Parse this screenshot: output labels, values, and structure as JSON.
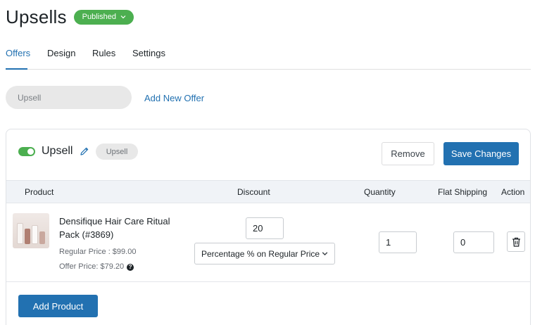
{
  "header": {
    "title": "Upsells",
    "status": "Published"
  },
  "tabs": [
    {
      "label": "Offers",
      "active": true
    },
    {
      "label": "Design",
      "active": false
    },
    {
      "label": "Rules",
      "active": false
    },
    {
      "label": "Settings",
      "active": false
    }
  ],
  "offer_selector": {
    "current": "Upsell",
    "add_label": "Add New Offer"
  },
  "offer": {
    "name": "Upsell",
    "tag": "Upsell",
    "enabled": true,
    "remove_label": "Remove",
    "save_label": "Save Changes",
    "columns": [
      "Product",
      "Discount",
      "Quantity",
      "Flat Shipping",
      "Action"
    ],
    "product": {
      "title": "Densifique Hair Care Ritual Pack (#3869)",
      "regular_price": "Regular Price : $99.00",
      "offer_price": "Offer Price: $79.20",
      "discount_value": "20",
      "discount_type": "Percentage % on Regular Price",
      "quantity": "1",
      "flat_shipping": "0"
    },
    "add_product_label": "Add Product"
  },
  "colors": {
    "accent": "#2271b1",
    "success": "#4caf50"
  }
}
